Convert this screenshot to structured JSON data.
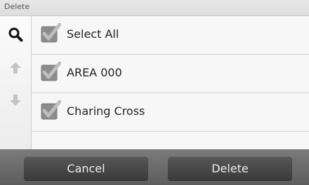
{
  "window": {
    "title": "Delete"
  },
  "sidebar": {
    "icons": [
      "search-icon",
      "arrow-up-icon",
      "arrow-down-icon"
    ]
  },
  "list": {
    "items": [
      {
        "label": "Select All",
        "checked": true
      },
      {
        "label": "AREA 000",
        "checked": true
      },
      {
        "label": "Charing Cross",
        "checked": true
      }
    ]
  },
  "footer": {
    "cancel_label": "Cancel",
    "delete_label": "Delete"
  },
  "colors": {
    "checkbox_fill": "#8c8c8c",
    "checkmark": "#bdbdbd",
    "button_bg": "#474747",
    "bar_bg": "#6b6b6b"
  }
}
